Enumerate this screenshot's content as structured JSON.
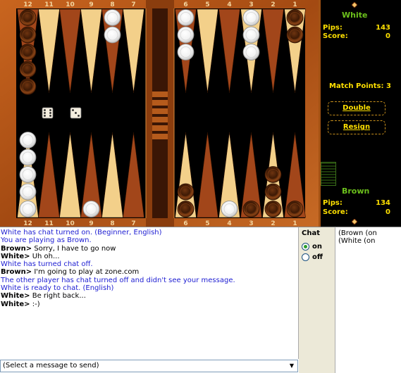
{
  "board": {
    "top_labels": [
      "12",
      "11",
      "10",
      "9",
      "8",
      "7",
      "6",
      "5",
      "4",
      "3",
      "2",
      "1"
    ],
    "bottom_labels": [
      "12",
      "11",
      "10",
      "9",
      "8",
      "7",
      "6",
      "5",
      "4",
      "3",
      "2",
      "1"
    ],
    "dice": [
      {
        "value": 6,
        "name": "die-left"
      },
      {
        "value": 3,
        "name": "die-right"
      }
    ],
    "checkers": {
      "top": [
        5,
        0,
        0,
        0,
        2,
        0,
        3,
        0,
        0,
        3,
        0,
        2
      ],
      "top_colors": [
        "brown",
        "",
        "",
        "",
        "white",
        "",
        "white",
        "",
        "",
        "white",
        "",
        "brown"
      ],
      "bottom": [
        5,
        0,
        0,
        1,
        0,
        0,
        2,
        0,
        1,
        1,
        3,
        1
      ],
      "bottom_colors": [
        "white",
        "",
        "",
        "white",
        "",
        "",
        "brown",
        "",
        "white",
        "brown",
        "brown",
        "brown"
      ]
    }
  },
  "side": {
    "white": {
      "title": "White",
      "pips_label": "Pips:",
      "pips": "143",
      "score_label": "Score:",
      "score": "0"
    },
    "brown": {
      "title": "Brown",
      "pips_label": "Pips:",
      "pips": "134",
      "score_label": "Score:",
      "score": "0"
    },
    "match_points": "Match Points: 3",
    "double_label": "Double",
    "resign_label": "Resign",
    "colors": {
      "accent_green": "#6cc01c",
      "accent_yellow": "#ffe000"
    }
  },
  "chat": {
    "lines": [
      {
        "type": "sys",
        "text": "White has chat turned on.  (Beginner, English)"
      },
      {
        "type": "sys",
        "text": "You are playing as Brown."
      },
      {
        "type": "msg",
        "who": "Brown>",
        "text": " Sorry, I have to go now"
      },
      {
        "type": "msg",
        "who": "White>",
        "text": " Uh oh..."
      },
      {
        "type": "sys",
        "text": "White has turned chat off."
      },
      {
        "type": "msg",
        "who": "Brown>",
        "text": " I'm going to play at zone.com"
      },
      {
        "type": "sys",
        "text": "The other player has chat turned off and didn't see your message."
      },
      {
        "type": "sys",
        "text": "White is ready to chat.  (English)"
      },
      {
        "type": "msg",
        "who": "White>",
        "text": " Be right back..."
      },
      {
        "type": "msg",
        "who": "White>",
        "text": " :-)"
      }
    ],
    "control_title": "Chat",
    "on_label": "on",
    "off_label": "off",
    "users": [
      "(Brown (on",
      "(White (on"
    ],
    "select_placeholder": "(Select a message to send)"
  }
}
